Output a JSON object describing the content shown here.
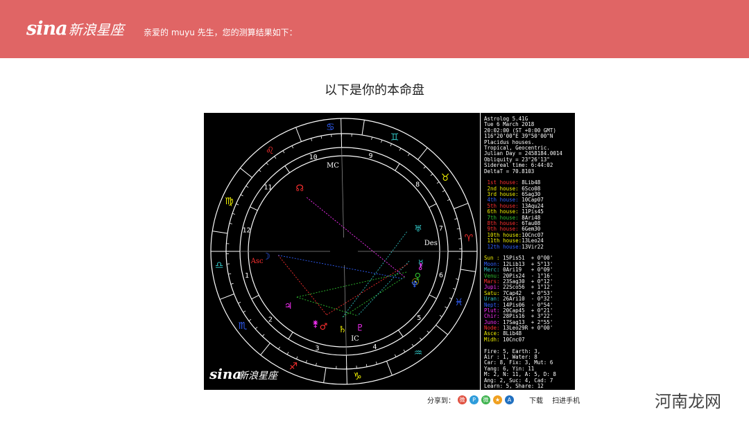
{
  "header": {
    "logo_text": "sina",
    "logo_cn": "新浪星座",
    "greeting": "亲爱的 muyu 先生，您的测算结果如下："
  },
  "page_title": "以下是你的本命盘",
  "chart_watermark": {
    "logo_text": "sina",
    "logo_cn": "新浪星座"
  },
  "info_panel": {
    "header_lines": [
      "Astrolog 5.41G",
      "Tue 6 March 2018",
      "20:02:00 (ST +0:00 GMT)",
      "116°20'00\"E 39°50'00\"N",
      "Placidus houses.",
      "Tropical, Geocentric.",
      "Julian Day = 2458184.0014",
      "Obliquity = 23°26'13\"",
      "Sidereal time: 6:44:02",
      "DeltaT = 70.8103"
    ],
    "houses": [
      {
        "label": "1st house:",
        "value": "8Lib48",
        "color": "#ff3030"
      },
      {
        "label": "2nd house:",
        "value": "6Sco08",
        "color": "#f0f000"
      },
      {
        "label": "3rd house:",
        "value": "6Sag30",
        "color": "#f0f000"
      },
      {
        "label": "4th house:",
        "value": "10Cap07",
        "color": "#3060ff"
      },
      {
        "label": "5th house:",
        "value": "13Aqu24",
        "color": "#ff3030"
      },
      {
        "label": "6th house:",
        "value": "11Pis45",
        "color": "#f0f000"
      },
      {
        "label": "7th house:",
        "value": "8Ari48",
        "color": "#30c030"
      },
      {
        "label": "8th house:",
        "value": "6Tau08",
        "color": "#ff3030"
      },
      {
        "label": "9th house:",
        "value": "6Gem30",
        "color": "#ff3030"
      },
      {
        "label": "10th house:",
        "value": "10Cnc07",
        "color": "#f0f000"
      },
      {
        "label": "11th house:",
        "value": "13Leo24",
        "color": "#f0f000"
      },
      {
        "label": "12th house:",
        "value": "13Vir22",
        "color": "#3060ff"
      }
    ],
    "planets": [
      {
        "name": "Sun :",
        "pos": "15Pis51",
        "speed": "+ 0°00'",
        "color": "#f0f000"
      },
      {
        "name": "Moon:",
        "pos": "12Lib13",
        "speed": "+ 5°13'",
        "color": "#3060ff"
      },
      {
        "name": "Merc:",
        "pos": "0Ari19",
        "speed": "+ 0°09'",
        "color": "#30c0c0"
      },
      {
        "name": "Venu:",
        "pos": "20Pis24",
        "speed": "- 1°16'",
        "color": "#30c030"
      },
      {
        "name": "Mars:",
        "pos": "23Sag30",
        "speed": "+ 0°12'",
        "color": "#ff3030"
      },
      {
        "name": "Jupi:",
        "pos": "22Sco56",
        "speed": "+ 1°12'",
        "color": "#ff30ff"
      },
      {
        "name": "Satu:",
        "pos": "7Cap42",
        "speed": "+ 0°53'",
        "color": "#f0f000"
      },
      {
        "name": "Uran:",
        "pos": "26Ari10",
        "speed": "- 0°32'",
        "color": "#30c0c0"
      },
      {
        "name": "Nept:",
        "pos": "14Pis06",
        "speed": "- 0°54'",
        "color": "#3060ff"
      },
      {
        "name": "Plut:",
        "pos": "20Cap45",
        "speed": "+ 0°21'",
        "color": "#ff30ff"
      },
      {
        "name": "Chir:",
        "pos": "28Pis16",
        "speed": "+ 3°22'",
        "color": "#ff30ff"
      },
      {
        "name": "Juno:",
        "pos": "17Sag13",
        "speed": "+ 2°55'",
        "color": "#ff30ff"
      },
      {
        "name": "Node:",
        "pos": "13Leo29R",
        "speed": "+ 0°00'",
        "color": "#ff3030"
      },
      {
        "name": "Asce:",
        "pos": "8Lib48",
        "speed": "",
        "color": "#f0f000"
      },
      {
        "name": "Midh:",
        "pos": "10Cnc07",
        "speed": "",
        "color": "#f0f000"
      }
    ],
    "footer_lines": [
      "Fire: 5, Earth: 3,",
      "Air : 1, Water: 8",
      "Car: 8, Fix: 3, Mut: 6",
      "Yang: 6, Yin: 11",
      "M: 2, N: 11, A: 5, D: 8",
      "Ang: 2, Suc: 4, Cad: 7",
      "Learn: 5, Share: 12"
    ]
  },
  "wheel": {
    "house_numbers": [
      "1",
      "2",
      "3",
      "4",
      "5",
      "6",
      "7",
      "8",
      "9",
      "10",
      "11",
      "12"
    ],
    "angle_labels": {
      "asc": "Asc",
      "mc": "MC",
      "des": "Des",
      "ic": "IC"
    }
  },
  "share": {
    "label": "分享到：",
    "icons": [
      {
        "name": "weibo-icon",
        "color": "#e05040",
        "glyph": "微"
      },
      {
        "name": "qzone-icon",
        "color": "#2e9cdb",
        "glyph": "P"
      },
      {
        "name": "wechat-icon",
        "color": "#3fb34f",
        "glyph": "微"
      },
      {
        "name": "qqspace-icon",
        "color": "#f0a020",
        "glyph": "★"
      },
      {
        "name": "qq-icon",
        "color": "#2070c0",
        "glyph": "A"
      }
    ],
    "download": "下载",
    "scan": "扫进手机"
  },
  "watermark": "河南龙网"
}
